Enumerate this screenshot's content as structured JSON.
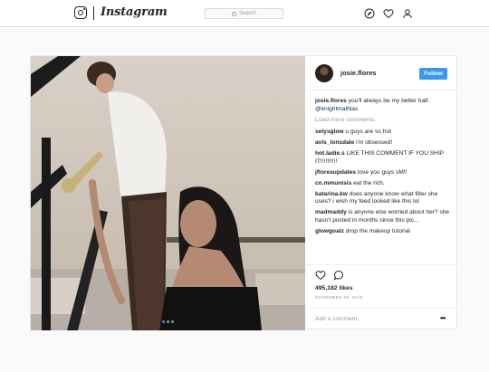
{
  "header": {
    "logo_text": "Instagram",
    "search_placeholder": "Search",
    "icons": [
      "compass-icon",
      "heart-icon",
      "profile-icon"
    ]
  },
  "post": {
    "username": "josie.flores",
    "follow_label": "Follow",
    "carousel": {
      "slide_count": 3,
      "active_index": 0
    },
    "caption": {
      "user": "josie.flores",
      "text": "you'll always be my better half.",
      "mention": "@knightmathias"
    },
    "load_more_label": "Load more comments",
    "comments": [
      {
        "user": "selysglow",
        "text": "u guys are so hot"
      },
      {
        "user": "avis_lonsdale",
        "text": "i'm obsessed!"
      },
      {
        "user": "hot.ladie.s",
        "text": "LIKE THIS COMMENT IF YOU SHIP IT!!!!!!!!!!"
      },
      {
        "user": "jfloresupdates",
        "text": "love you guys sM!!"
      },
      {
        "user": "co.mmunisis",
        "text": "eat the rich."
      },
      {
        "user": "katarina.kw",
        "text": "does anyone know what filter she uses? i wish my feed looked like this lol"
      },
      {
        "user": "madmaddy",
        "text": "is anyone else worried about her? she hasn't posted in months since this pic..."
      },
      {
        "user": "glowgoalz",
        "text": "drop the makeup tutorial"
      }
    ],
    "likes_label": "495,182 likes",
    "date_label": "NOVEMBER 20, 2019",
    "add_comment_placeholder": "Add a comment...",
    "more_options_label": "•••"
  },
  "colors": {
    "accent": "#3897f0",
    "text": "#262626",
    "muted": "#999999",
    "border": "#dbdbdb",
    "mention": "#003569"
  }
}
